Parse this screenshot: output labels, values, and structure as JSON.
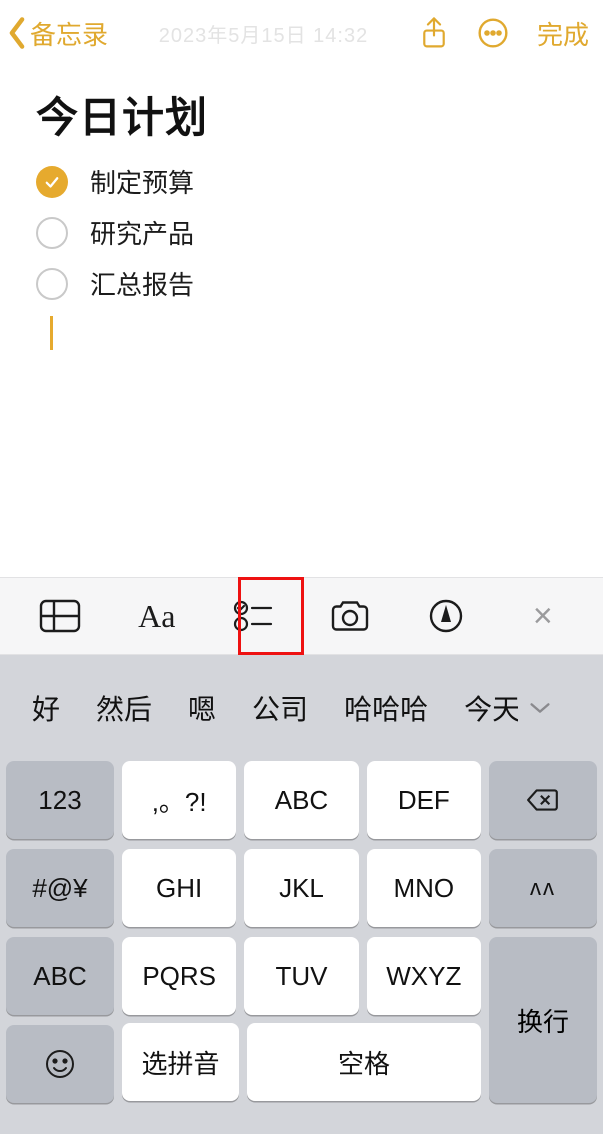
{
  "nav": {
    "back_label": "备忘录",
    "timestamp": "2023年5月15日 14:32",
    "done_label": "完成"
  },
  "note": {
    "title": "今日计划",
    "items": [
      {
        "text": "制定预算",
        "checked": true
      },
      {
        "text": "研究产品",
        "checked": false
      },
      {
        "text": "汇总报告",
        "checked": false
      }
    ]
  },
  "toolbar": {
    "aa_label": "Aa",
    "close_glyph": "×"
  },
  "keyboard": {
    "candidates": [
      "好",
      "然后",
      "嗯",
      "公司",
      "哈哈哈",
      "今天"
    ],
    "keys": {
      "num": "123",
      "punct": ",。?!",
      "abc1": "ABC",
      "def": "DEF",
      "sym": "#@¥",
      "ghi": "GHI",
      "jkl": "JKL",
      "mno": "MNO",
      "caret": "ᴧᴧ",
      "abc2": "ABC",
      "pqrs": "PQRS",
      "tuv": "TUV",
      "wxyz": "WXYZ",
      "pinyin": "选拼音",
      "space": "空格",
      "enter": "换行"
    }
  }
}
